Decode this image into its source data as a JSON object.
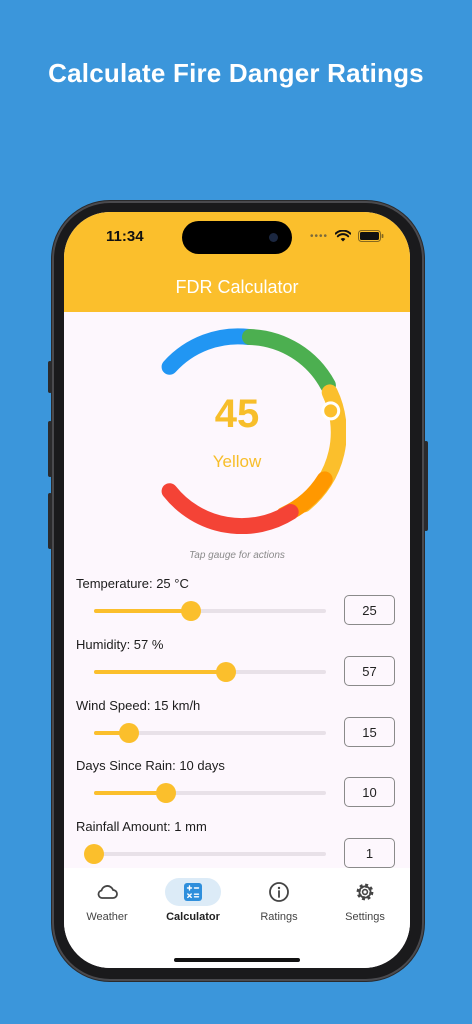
{
  "headline": "Calculate Fire Danger Ratings",
  "status": {
    "time": "11:34"
  },
  "app": {
    "title": "FDR Calculator"
  },
  "gauge": {
    "value": "45",
    "rating": "Yellow",
    "hint": "Tap gauge for actions",
    "colors": {
      "blue": "#2196F3",
      "green": "#4CAF50",
      "yellow": "#FBBF2C",
      "orange": "#FF9800",
      "red": "#F44336"
    }
  },
  "inputs": [
    {
      "label": "Temperature: 25 °C",
      "value": "25",
      "fraction": 0.42
    },
    {
      "label": "Humidity: 57 %",
      "value": "57",
      "fraction": 0.57
    },
    {
      "label": "Wind Speed: 15 km/h",
      "value": "15",
      "fraction": 0.15
    },
    {
      "label": "Days Since Rain: 10 days",
      "value": "10",
      "fraction": 0.31
    },
    {
      "label": "Rainfall Amount: 1 mm",
      "value": "1",
      "fraction": 0.0
    }
  ],
  "nav": [
    {
      "label": "Weather",
      "icon": "cloud-icon"
    },
    {
      "label": "Calculator",
      "icon": "calculator-icon",
      "active": true
    },
    {
      "label": "Ratings",
      "icon": "info-icon"
    },
    {
      "label": "Settings",
      "icon": "gear-icon"
    }
  ],
  "accent": "#FBBF2C",
  "background": "#3B96DB"
}
